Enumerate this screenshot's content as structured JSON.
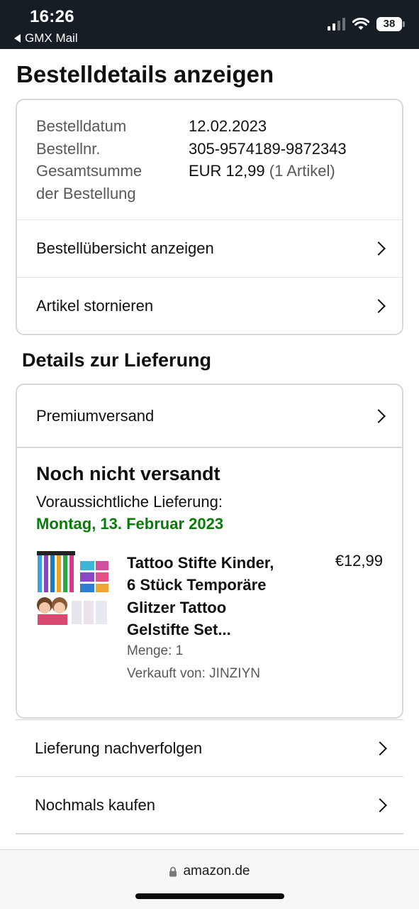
{
  "status_bar": {
    "time": "16:26",
    "back_app": "GMX Mail",
    "battery": "38",
    "icons": [
      "cellular-signal-icon",
      "wifi-icon",
      "battery-icon"
    ]
  },
  "page_title": "Bestelldetails anzeigen",
  "order_info": {
    "date_label": "Bestelldatum",
    "date_value": "12.02.2023",
    "number_label": "Bestellnr.",
    "number_value": "305-9574189-9872343",
    "total_label_line1": "Gesamtsumme",
    "total_label_line2": "der Bestellung",
    "total_value": "EUR 12,99",
    "total_items": "(1 Artikel)"
  },
  "order_actions": {
    "overview": "Bestellübersicht anzeigen",
    "cancel": "Artikel stornieren"
  },
  "delivery": {
    "section_title": "Details zur Lieferung",
    "shipping_type": "Premiumversand",
    "status": "Noch nicht versandt",
    "eta_label": "Voraussichtliche Lieferung:",
    "eta_date": "Montag, 13. Februar 2023",
    "eta_color": "#067d06"
  },
  "product": {
    "title_line1": "Tattoo Stifte Kinder,",
    "title_line2": "6 Stück Temporäre",
    "title_line3": "Glitzer Tattoo",
    "title_line4": "Gelstifte Set...",
    "price": "€12,99",
    "quantity": "Menge: 1",
    "seller": "Verkauft von: JINZIYN"
  },
  "more_actions": {
    "track": "Lieferung nachverfolgen",
    "buy_again": "Nochmals kaufen"
  },
  "browser": {
    "domain": "amazon.de"
  }
}
